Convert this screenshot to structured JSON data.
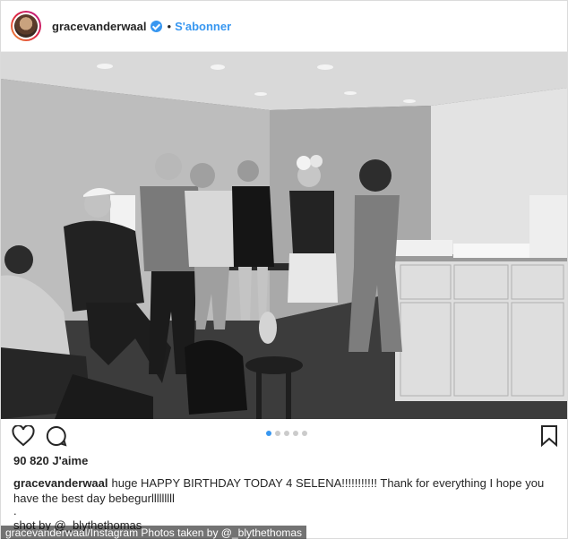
{
  "header": {
    "username": "gracevanderwaal",
    "separator": "•",
    "follow_label": "S'abonner"
  },
  "post": {
    "likes": "90 820 J'aime",
    "caption_user": "gracevanderwaal",
    "caption_text": "huge HAPPY BIRTHDAY TODAY 4 SELENA!!!!!!!!!!! Thank for everything I hope you have the best day bebegurlllllllll",
    "caption_dot": ".",
    "shot_by": "shot by @_blythethomas",
    "carousel": {
      "count": 5,
      "active_index": 0
    }
  },
  "icons": {
    "like": "heart-icon",
    "comment": "comment-icon",
    "save": "bookmark-icon",
    "verified": "verified-badge-icon"
  },
  "colors": {
    "accent": "#3897f0",
    "text": "#262626",
    "border": "#dbdbdb"
  },
  "credit": "gracevanderwaal/Instagram Photos taken by @_blythethomas"
}
